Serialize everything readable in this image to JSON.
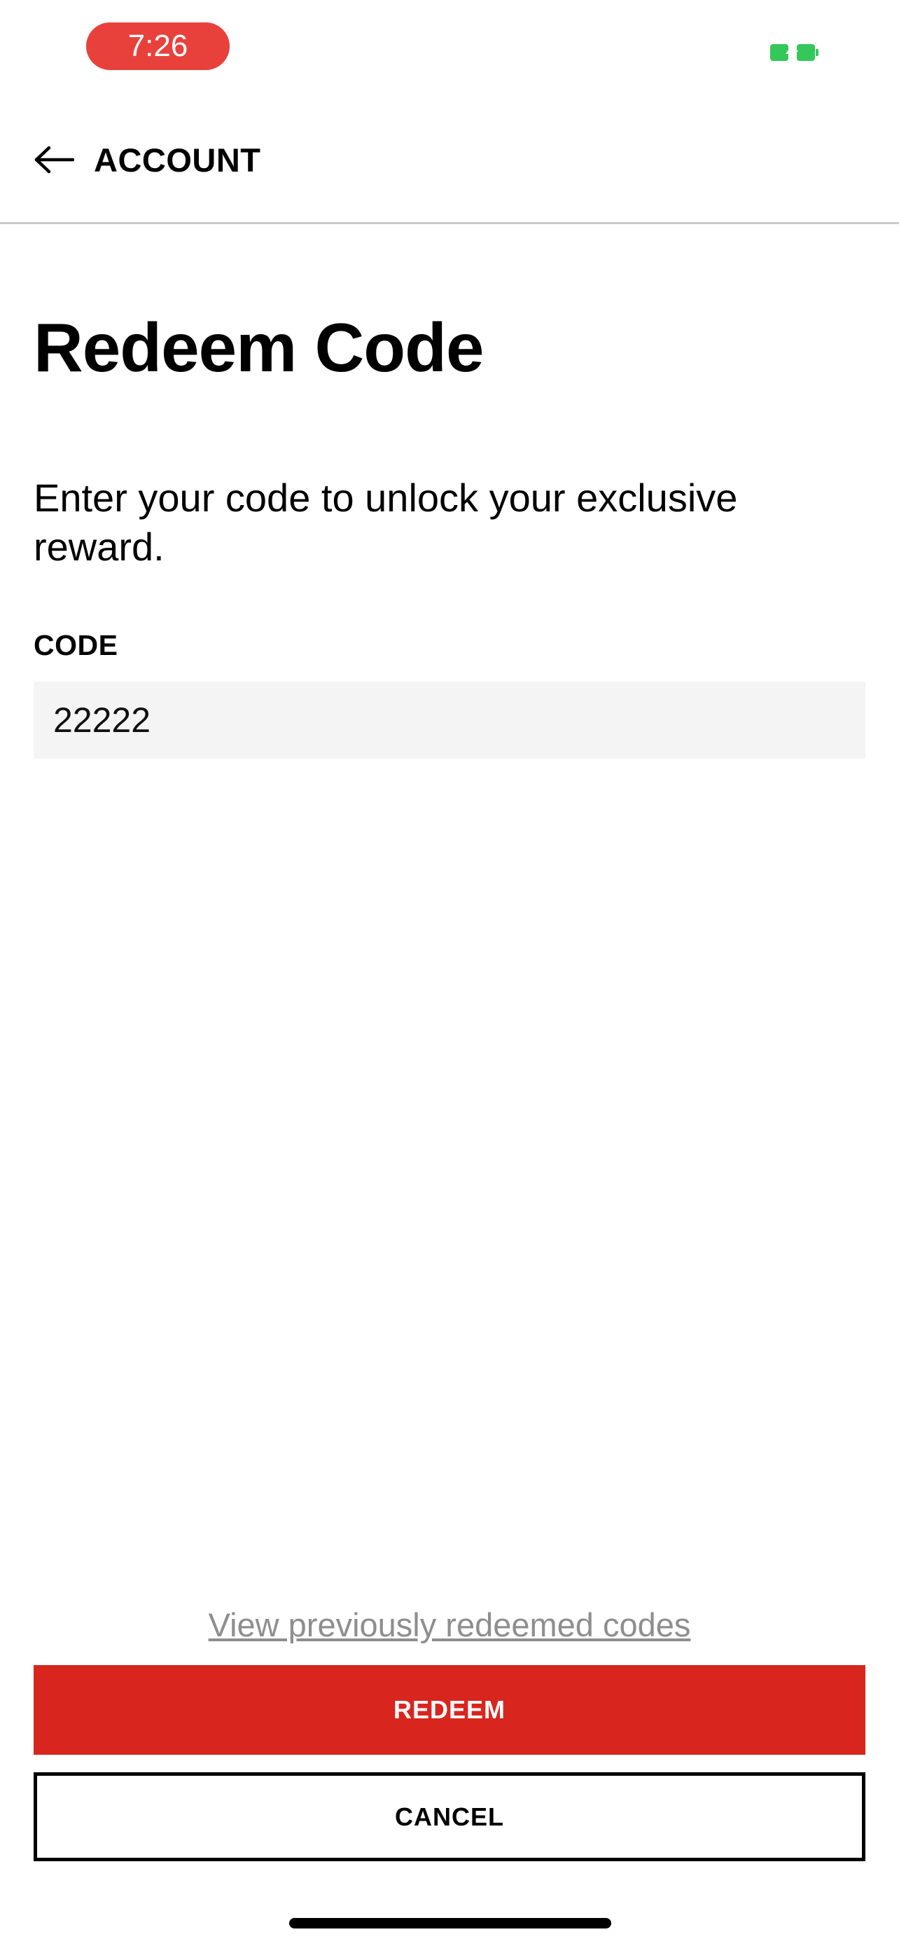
{
  "status_bar": {
    "time": "7:26",
    "time_pill_color": "#e8413c",
    "battery_icon": "battery-charging-icon",
    "battery_color": "#34c759"
  },
  "header": {
    "back_icon": "arrow-left-icon",
    "back_label": "ACCOUNT"
  },
  "main": {
    "title": "Redeem Code",
    "description": "Enter your code to unlock your exclusive reward.",
    "code_field": {
      "label": "CODE",
      "value": "22222",
      "placeholder": ""
    }
  },
  "footer": {
    "history_link": "View previously redeemed codes",
    "redeem_label": "REDEEM",
    "cancel_label": "CANCEL"
  },
  "colors": {
    "accent": "#d8261e",
    "input_background": "#f4f4f4",
    "link_gray": "#8e8e8e"
  }
}
